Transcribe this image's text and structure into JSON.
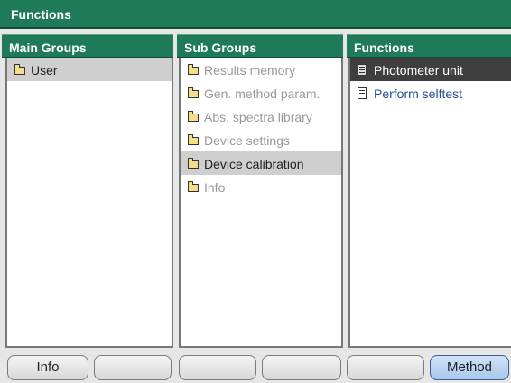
{
  "window": {
    "title": "Functions"
  },
  "columns": {
    "main_groups": {
      "header": "Main Groups",
      "items": [
        {
          "label": "User",
          "state": "selected"
        }
      ]
    },
    "sub_groups": {
      "header": "Sub Groups",
      "items": [
        {
          "label": "Results memory",
          "state": "disabled"
        },
        {
          "label": "Gen. method param.",
          "state": "disabled"
        },
        {
          "label": "Abs. spectra library",
          "state": "disabled"
        },
        {
          "label": "Device settings",
          "state": "disabled"
        },
        {
          "label": "Device calibration",
          "state": "selected"
        },
        {
          "label": "Info",
          "state": "disabled"
        }
      ]
    },
    "functions": {
      "header": "Functions",
      "items": [
        {
          "label": "Photometer unit",
          "state": "highlighted"
        },
        {
          "label": "Perform selftest",
          "state": "link"
        }
      ]
    }
  },
  "softkeys": [
    "Info",
    "",
    "",
    "",
    "",
    "Method"
  ],
  "colors": {
    "header_bg": "#1f7a5a",
    "highlight": "#3f3f3f",
    "link": "#1f4f96"
  }
}
